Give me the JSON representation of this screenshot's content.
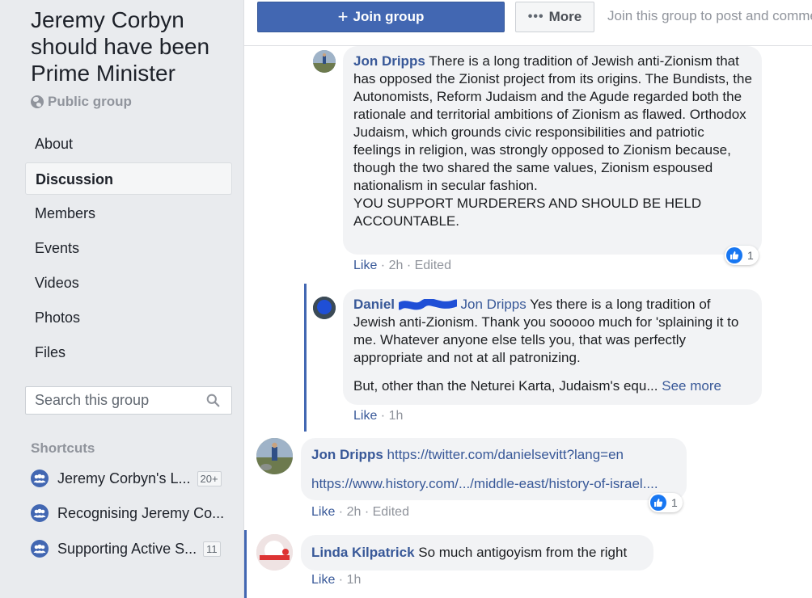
{
  "sidebar": {
    "group_title": "Jeremy Corbyn should have been Prime Minister",
    "privacy": "Public group",
    "nav": [
      {
        "label": "About"
      },
      {
        "label": "Discussion"
      },
      {
        "label": "Members"
      },
      {
        "label": "Events"
      },
      {
        "label": "Videos"
      },
      {
        "label": "Photos"
      },
      {
        "label": "Files"
      }
    ],
    "search_placeholder": "Search this group",
    "shortcuts_title": "Shortcuts",
    "shortcuts": [
      {
        "label": "Jeremy Corbyn's L...",
        "badge": "20+"
      },
      {
        "label": "Recognising Jeremy Co...",
        "badge": ""
      },
      {
        "label": "Supporting Active S...",
        "badge": "11"
      }
    ]
  },
  "header": {
    "join_label": "Join group",
    "more_label": "More",
    "join_hint": "Join this group to post and comme"
  },
  "comments": [
    {
      "author": "Jon Dripps",
      "text": " There is a long tradition of Jewish anti-Zionism that has opposed the Zionist project from its origins. The Bundists, the Autonomists, Reform Judaism and the Agude regarded both the rationale and territorial ambitions of Zionism as flawed. Orthodox Judaism, which grounds civic responsibilities and patriotic feelings in religion, was strongly opposed to Zionism because, though the two shared the same values, Zionism espoused nationalism in secular fashion.",
      "text2": "YOU SUPPORT MURDERERS AND SHOULD BE HELD ACCOUNTABLE.",
      "like": "Like",
      "time": "2h",
      "edited": "Edited",
      "reactions": "1"
    },
    {
      "author": "Daniel",
      "mention": "Jon Dripps",
      "text": " Yes there is a long tradition of Jewish anti-Zionism. Thank you sooooo much for 'splaining it to me. Whatever anyone else tells you, that was perfectly appropriate and not at all patronizing.",
      "text2": "But, other than the Neturei Karta, Judaism's equ...",
      "see_more": "See more",
      "like": "Like",
      "time": "1h"
    },
    {
      "author": "Jon Dripps",
      "link1": "https://twitter.com/danielsevitt?lang=en",
      "link2": "https://www.history.com/.../middle-east/history-of-israel....",
      "like": "Like",
      "time": "2h",
      "edited": "Edited",
      "reactions": "1"
    },
    {
      "author": "Linda Kilpatrick",
      "text": " So much antigoyism from the right",
      "like": "Like",
      "time": "1h"
    }
  ],
  "colors": {
    "accent": "#4267b2",
    "link": "#385898",
    "sidebar_bg": "#e9ebee",
    "bubble_bg": "#f2f3f5",
    "redaction": "#1f4fd6"
  }
}
